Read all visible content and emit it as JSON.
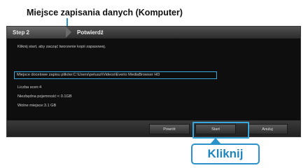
{
  "annotation": {
    "caption": "Miejsce zapisania danych (Komputer)",
    "callout": "Kliknij"
  },
  "window": {
    "step_label": "Step 2",
    "step_title": "Potwierdź",
    "lines": {
      "instruction": "Kliknij start, aby zacząć tworzenie kopii zapasowej.",
      "location": "Miejsce docelowe zapisu plików:C:\\Users\\petuszi\\Videos\\Everio MediaBrowser HD",
      "scene_count": "Liczba scen:4",
      "required_space": "Niezbędna pojemność:< 0.1GB",
      "free_space": "Wolne miejsce:3.1 GB"
    },
    "buttons": {
      "back": "Powrót",
      "start": "Start",
      "cancel": "Anuluj"
    }
  },
  "colors": {
    "accent": "#2a93c9",
    "highlight": "#3aa7dc",
    "window_bg": "#121212"
  }
}
